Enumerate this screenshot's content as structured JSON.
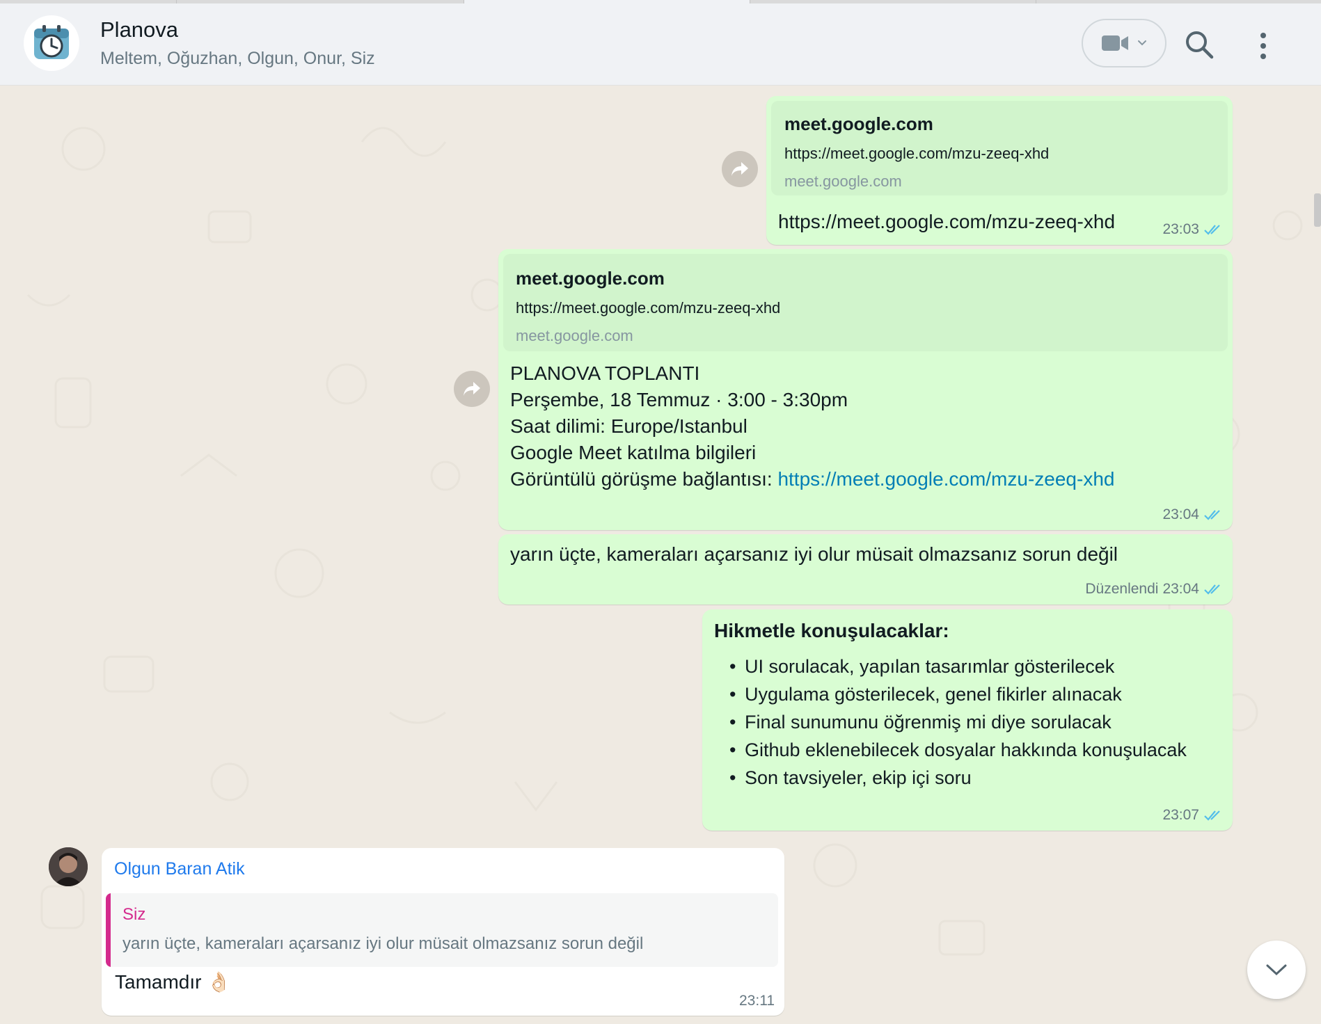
{
  "header": {
    "title": "Planova",
    "members": "Meltem, Oğuzhan, Olgun, Onur, Siz"
  },
  "icons": {
    "avatar": "clock-icon",
    "video": "video-camera-icon",
    "search": "search-icon",
    "menu": "more-vertical-icon",
    "forward": "forward-icon",
    "read": "double-check-icon",
    "scroll": "chevron-down-icon"
  },
  "colors": {
    "outgoing_bubble": "#d9fdd3",
    "incoming_bubble": "#ffffff",
    "link": "#027eb5",
    "read_tick": "#53bdeb",
    "sender_name": "#1f7aec",
    "quote_accent": "#d42a8d",
    "chat_background": "#efeae2"
  },
  "messages": [
    {
      "preview": {
        "title": "meet.google.com",
        "description": "https://meet.google.com/mzu-zeeq-xhd",
        "domain": "meet.google.com"
      },
      "link": "https://meet.google.com/mzu-zeeq-xhd",
      "time": "23:03"
    },
    {
      "preview": {
        "title": "meet.google.com",
        "description": "https://meet.google.com/mzu-zeeq-xhd",
        "domain": "meet.google.com"
      },
      "lines": [
        "PLANOVA TOPLANTI",
        "Perşembe, 18 Temmuz · 3:00 - 3:30pm",
        "Saat dilimi: Europe/Istanbul",
        "Google Meet katılma bilgileri"
      ],
      "link_prefix": "Görüntülü görüşme bağlantısı: ",
      "link": "https://meet.google.com/mzu-zeeq-xhd",
      "time": "23:04"
    },
    {
      "text": "yarın üçte, kameraları açarsanız iyi olur müsait olmazsanız sorun değil",
      "edited": "Düzenlendi",
      "time": "23:04"
    },
    {
      "heading": "Hikmetle konuşulacaklar:",
      "items": [
        "UI sorulacak, yapılan tasarımlar gösterilecek",
        "Uygulama gösterilecek, genel fikirler alınacak",
        "Final sunumunu öğrenmiş mi diye sorulacak",
        "Github eklenebilecek dosyalar hakkında konuşulacak",
        "Son tavsiyeler, ekip içi soru"
      ],
      "time": "23:07"
    },
    {
      "sender": "Olgun Baran Atik",
      "quote": {
        "author": "Siz",
        "text": "yarın üçte, kameraları açarsanız iyi olur müsait olmazsanız sorun değil"
      },
      "text": "Tamamdır",
      "emoji": "👌🏻",
      "time": "23:11"
    }
  ]
}
